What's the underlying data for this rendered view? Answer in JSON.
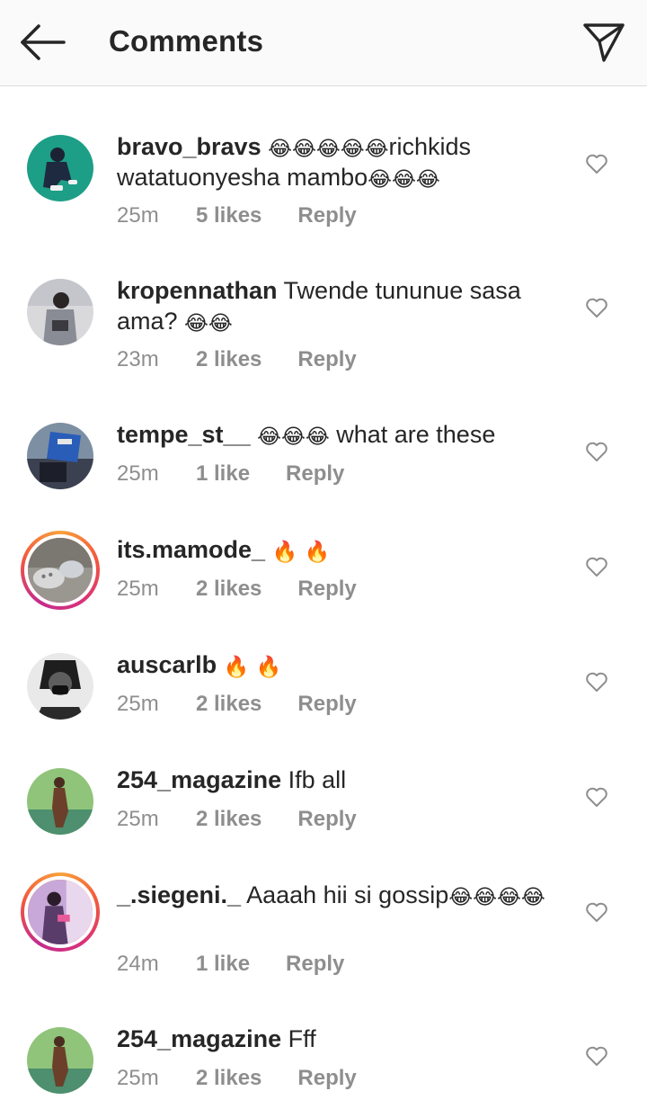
{
  "header": {
    "title": "Comments",
    "back_icon": "back-arrow-icon",
    "send_icon": "paper-plane-icon"
  },
  "colors": {
    "text": "#262626",
    "meta": "#8e8e8e",
    "header_bg": "#fafafa",
    "story_ring": "#e1306c"
  },
  "comments": [
    {
      "username": "bravo_bravs",
      "text_runs": [
        {
          "t": " "
        },
        {
          "e": "😂"
        },
        {
          "e": "😂"
        },
        {
          "e": "😂"
        },
        {
          "e": "😂"
        },
        {
          "e": "😂"
        },
        {
          "t": "richkids watatuonyesha mambo"
        },
        {
          "e": "😂"
        },
        {
          "e": "😂"
        },
        {
          "e": "😂"
        }
      ],
      "time": "25m",
      "likes": "5 likes",
      "reply": "Reply"
    },
    {
      "username": "kropennathan",
      "text_runs": [
        {
          "t": " Twende tununue sasa ama? "
        },
        {
          "e": "😂"
        },
        {
          "e": "😂"
        }
      ],
      "time": "23m",
      "likes": "2 likes",
      "reply": "Reply"
    },
    {
      "username": "tempe_st__",
      "text_runs": [
        {
          "t": " "
        },
        {
          "e": "😂"
        },
        {
          "e": "😂"
        },
        {
          "e": "😂"
        },
        {
          "t": " what are these"
        }
      ],
      "time": "25m",
      "likes": "1 like",
      "reply": "Reply"
    },
    {
      "username": "its.mamode_",
      "text_runs": [
        {
          "t": " "
        },
        {
          "e": "🔥"
        },
        {
          "t": " "
        },
        {
          "e": "🔥"
        }
      ],
      "time": "25m",
      "likes": "2 likes",
      "reply": "Reply"
    },
    {
      "username": "auscarlb",
      "text_runs": [
        {
          "t": " "
        },
        {
          "e": "🔥"
        },
        {
          "t": " "
        },
        {
          "e": "🔥"
        }
      ],
      "time": "25m",
      "likes": "2 likes",
      "reply": "Reply"
    },
    {
      "username": "254_magazine",
      "text_runs": [
        {
          "t": " Ifb all"
        }
      ],
      "time": "25m",
      "likes": "2 likes",
      "reply": "Reply"
    },
    {
      "username": "_.siegeni._",
      "text_runs": [
        {
          "t": " Aaaah hii si gossip"
        },
        {
          "e": "😂"
        },
        {
          "e": "😂"
        },
        {
          "e": "😂"
        },
        {
          "e": "😂"
        }
      ],
      "time": "24m",
      "likes": "1 like",
      "reply": "Reply"
    },
    {
      "username": "254_magazine",
      "text_runs": [
        {
          "t": " Fff"
        }
      ],
      "time": "25m",
      "likes": "2 likes",
      "reply": "Reply"
    }
  ]
}
